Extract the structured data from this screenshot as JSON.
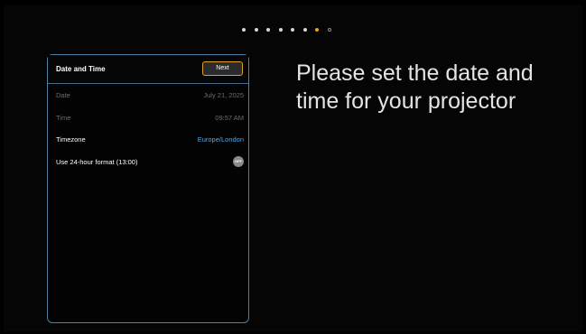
{
  "pagination": {
    "dots": [
      {
        "state": "filled"
      },
      {
        "state": "filled"
      },
      {
        "state": "filled"
      },
      {
        "state": "filled"
      },
      {
        "state": "filled"
      },
      {
        "state": "filled"
      },
      {
        "state": "active"
      },
      {
        "state": "empty"
      }
    ],
    "current_step": 7,
    "total_steps": 8
  },
  "panel": {
    "title": "Date and Time",
    "next_label": "Next",
    "rows": {
      "date": {
        "label": "Date",
        "value": "July 21, 2025"
      },
      "time": {
        "label": "Time",
        "value": "09:57 AM"
      },
      "timezone": {
        "label": "Timezone",
        "value": "Europe/London"
      },
      "format24": {
        "label": "Use 24-hour format (13:00)",
        "toggle": "OFF"
      }
    }
  },
  "headline": "Please set the date and time for your projector",
  "colors": {
    "accent": "#e8a317",
    "panel_border": "#4f7fa3",
    "link": "#5aa6dc",
    "dim_text": "#6d6d6d"
  }
}
